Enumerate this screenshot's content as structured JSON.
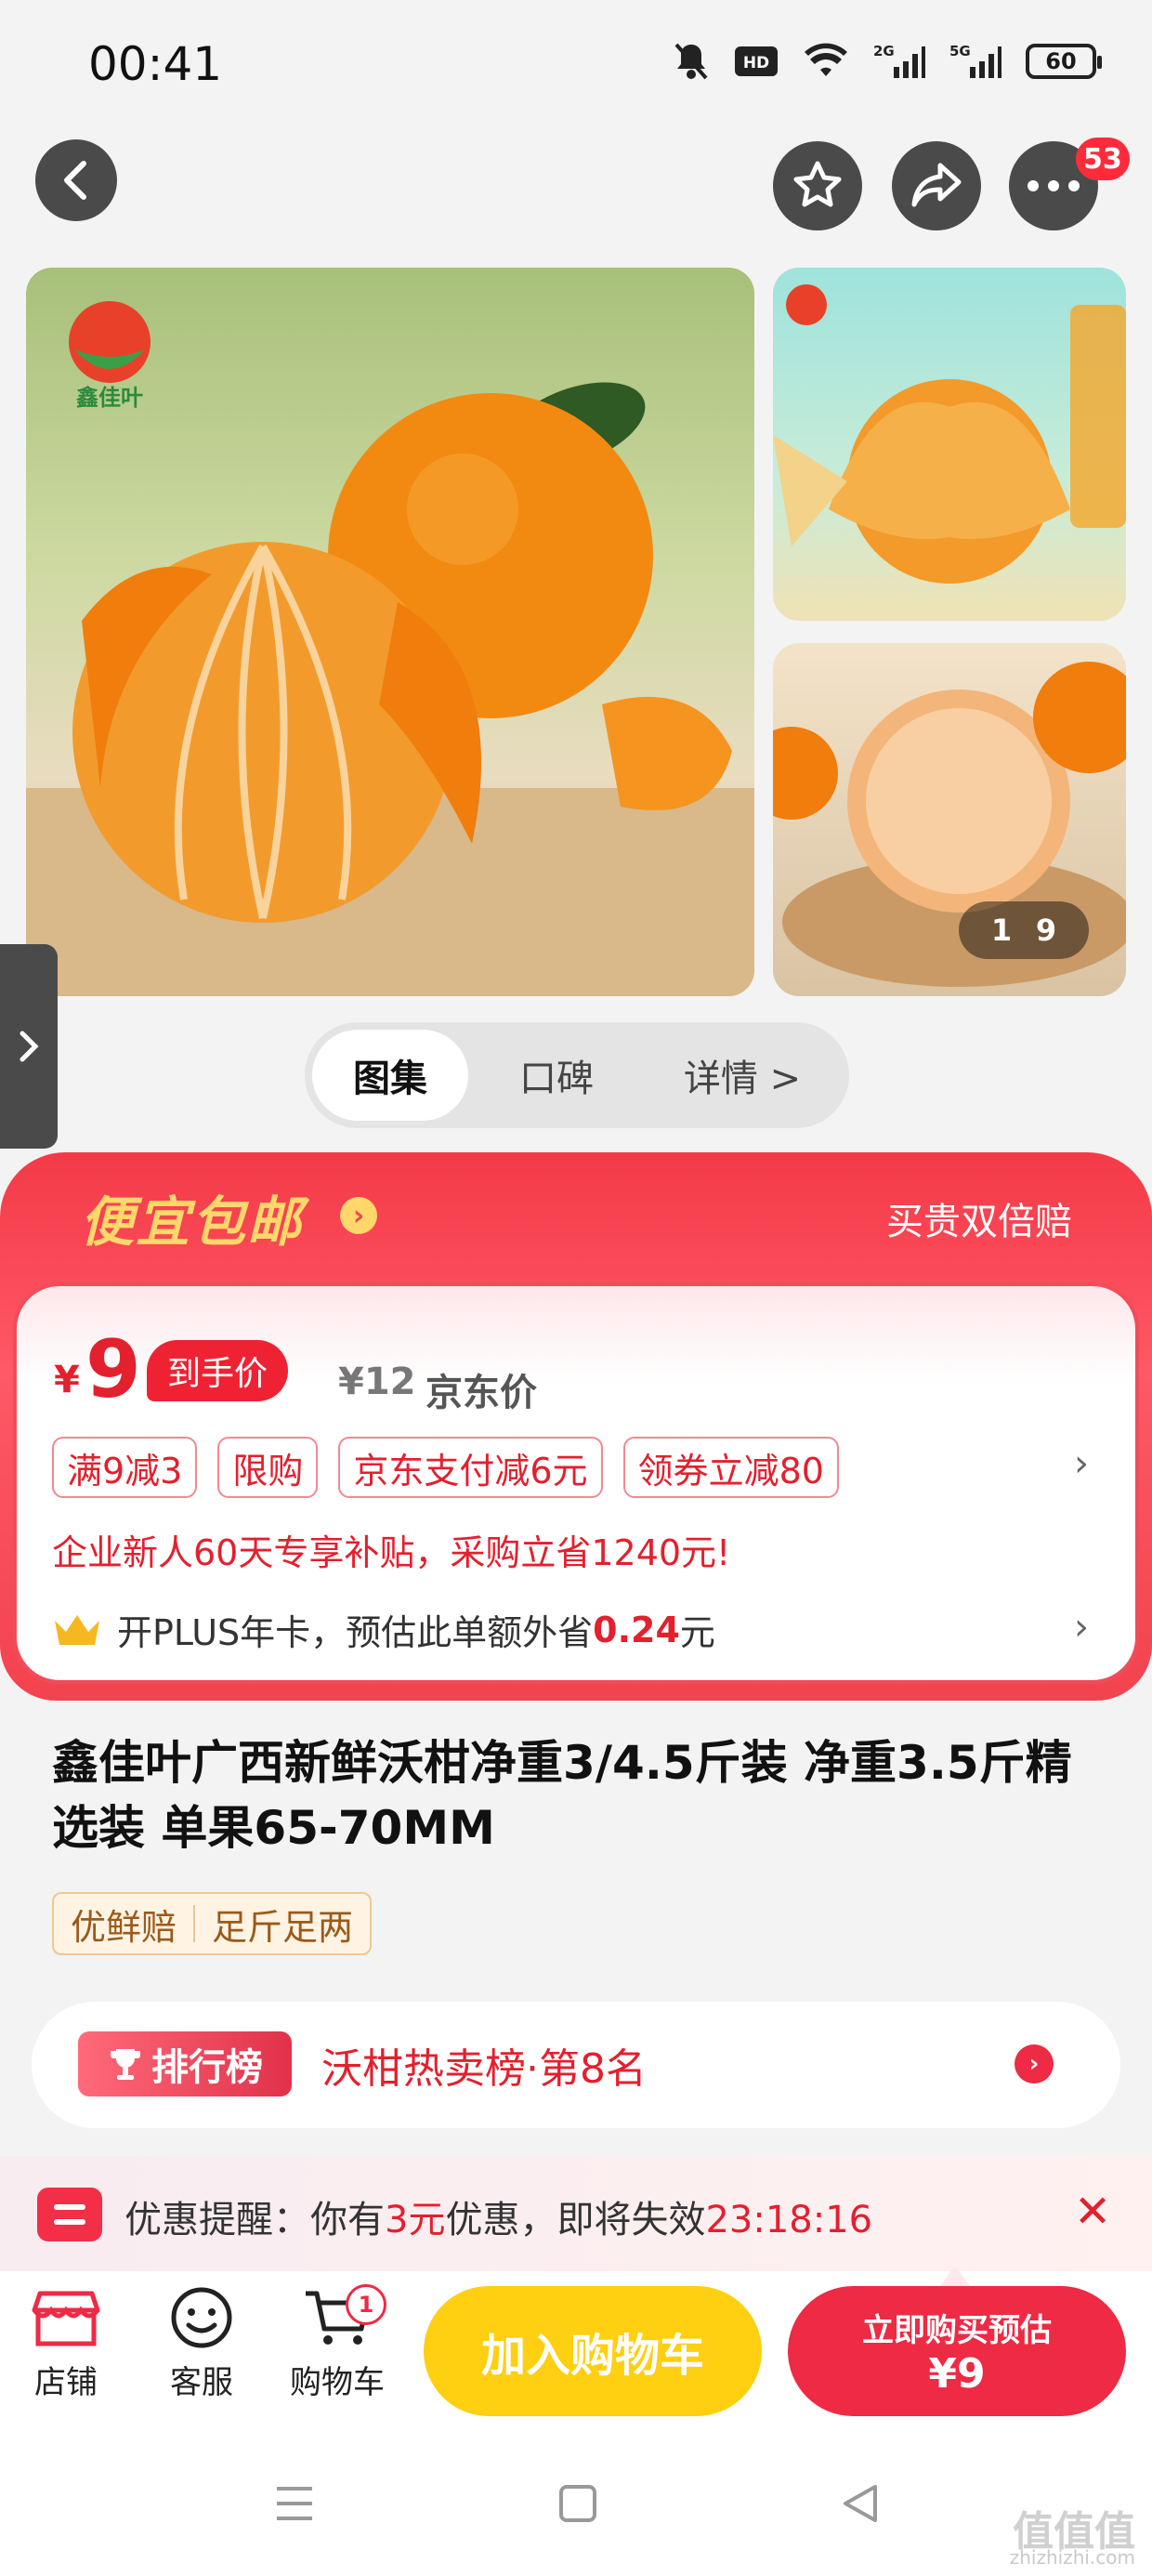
{
  "status_bar": {
    "time": "00:41",
    "battery": "60"
  },
  "top_actions": {
    "more_badge": "53"
  },
  "gallery": {
    "counter_current": "1",
    "counter_total": "9",
    "main_logo_text": "鑫佳叶"
  },
  "tabs": [
    {
      "label": "图集"
    },
    {
      "label": "口碑"
    },
    {
      "label": "详情 >"
    }
  ],
  "promo": {
    "headline": "便宜包邮",
    "right_text": "买贵双倍赔",
    "currency": "¥",
    "price": "9",
    "price_tag": "到手价",
    "original_price": "¥12",
    "original_label": "京东价",
    "coupons": [
      {
        "label": "满9减3"
      },
      {
        "label": "限购"
      },
      {
        "label": "京东支付减6元"
      },
      {
        "label": "领券立减80"
      }
    ],
    "subsidy_text": "企业新人60天专享补贴，采购立省1240元!",
    "plus_text_prefix": "开PLUS年卡，预估此单额外省",
    "plus_amount": "0.24",
    "plus_unit": "元"
  },
  "product": {
    "title": "鑫佳叶广西新鲜沃柑净重3/4.5斤装 净重3.5斤精选装 单果65-70MM",
    "tags": [
      "优鲜赔",
      "足斤足两"
    ]
  },
  "ranking": {
    "badge": "排行榜",
    "text": "沃柑热卖榜·第8名"
  },
  "reminder": {
    "prefix": "优惠提醒：你有",
    "count": "3元",
    "middle": "优惠，即将失效",
    "countdown": "23:18:16"
  },
  "bottom_bar": {
    "store_label": "店铺",
    "service_label": "客服",
    "cart_label": "购物车",
    "cart_count": "1",
    "add_cart_label": "加入购物车",
    "buy_label_line1": "立即购买预估",
    "buy_label_line2": "¥9"
  },
  "watermark": {
    "text": "值值值",
    "domain": "zhizhizhi.com"
  },
  "colors": {
    "accent_red": "#ee2a44",
    "accent_yellow": "#ffcf11",
    "promo_gold": "#ffd76a"
  }
}
